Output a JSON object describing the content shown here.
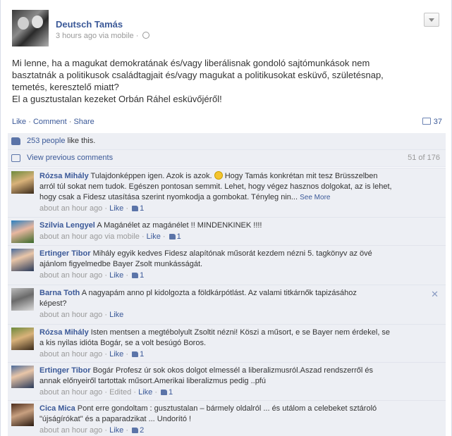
{
  "post": {
    "author": "Deutsch Tamás",
    "meta": "3 hours ago via mobile · ",
    "body_lines": [
      "Mi lenne, ha a magukat demokratának és/vagy liberálisnak gondoló sajtómunkások nem",
      "basztatnák a politikusok családtagjait és/vagy magukat a politikusokat esküvő, születésnap,",
      "temetés, keresztelő miatt?",
      "El a gusztustalan kezeket Orbán Ráhel esküvőjéről!"
    ],
    "actions": {
      "like": "Like",
      "comment": "Comment",
      "share": "Share",
      "sep": " · ",
      "comment_count": "37"
    }
  },
  "likes": {
    "people_link": "253 people",
    "rest": " like this."
  },
  "previous": {
    "label": "View previous comments",
    "counter": "51 of 176"
  },
  "comments": [
    {
      "author": "Rózsa Mihály",
      "lines": [
        " Tulajdonképpen igen. Azok is azok. ",
        " Hogy Tamás konkrétan mit tesz Brüsszelben",
        "arról túl sokat nem tudok. Egészen pontosan semmit. Lehet, hogy végez hasznos dolgokat, az is lehet,",
        "hogy csak a Fidesz utasítása szerint nyomkodja a gombokat. Tényleg nin..."
      ],
      "see_more": "See More",
      "time": "about an hour ago",
      "like": "Like",
      "likes": "1"
    },
    {
      "author": "Szilvia Lengyel",
      "lines": [
        " A Magánélet az magánélet !! MINDENKINEK !!!!"
      ],
      "time": "about an hour ago via mobile",
      "like": "Like",
      "likes": "1"
    },
    {
      "author": "Ertinger Tibor",
      "lines": [
        " Mihály egyik kedves Fidesz alapítónak műsorát kezdem nézni 5. tagkönyv az övé",
        "ajánlom figyelmedbe Bayer Zsolt munkásságát."
      ],
      "time": "about an hour ago",
      "like": "Like",
      "likes": "1"
    },
    {
      "author": "Barna Toth",
      "lines": [
        " A nagyapám anno pl kidolgozta a földkárpótlást. Az valami titkárnők tapizásához",
        "képest?"
      ],
      "time": "about an hour ago",
      "like": "Like",
      "close": "✕"
    },
    {
      "author": "Rózsa Mihály",
      "lines": [
        " Isten mentsen a megtébolyult Zsoltit nézni! Köszi a műsort, e se Bayer nem érdekel, se",
        "a kis nyilas idióta Bogár, se a volt besúgó Boros."
      ],
      "time": "about an hour ago",
      "like": "Like",
      "likes": "1"
    },
    {
      "author": "Ertinger Tibor",
      "lines": [
        " Bogár Profesz úr sok okos dolgot elmessél a liberalizmusról.Aszad rendszerről és",
        "annak előnyeiről tartottak műsort.Amerikai liberalizmus pedig ..pfú"
      ],
      "time": "about an hour ago",
      "edited": "Edited",
      "like": "Like",
      "likes": "1"
    },
    {
      "author": "Cica Mica",
      "lines": [
        " Pont erre gondoltam : gusztustalan – bármely oldalról ... és utálom a celebeket sztároló",
        "\"újságírókat\" és a paparadzikat ... Undorító !"
      ],
      "time": "about an hour ago",
      "like": "Like",
      "likes": "2"
    }
  ],
  "colors": {
    "link": "#3b5998",
    "comment_bg": "#edeff4",
    "muted": "#999999"
  }
}
